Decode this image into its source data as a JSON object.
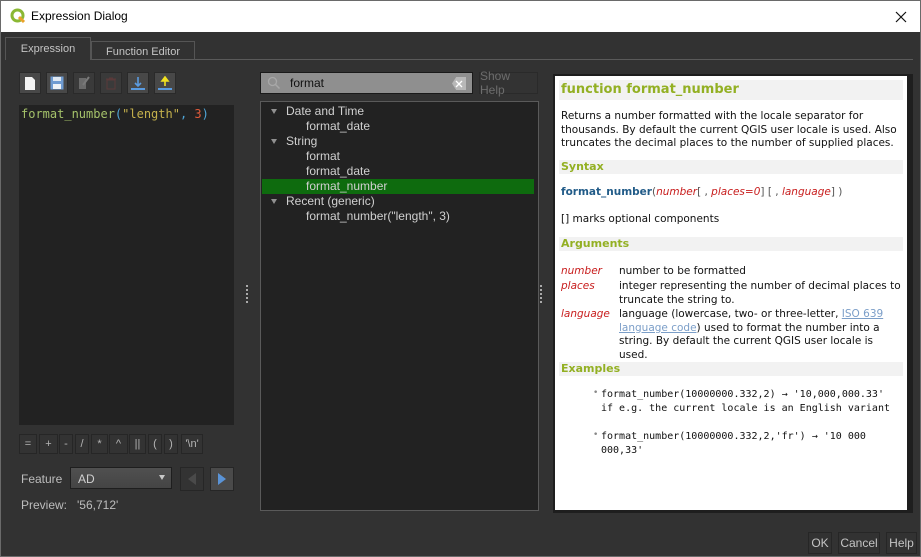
{
  "window": {
    "title": "Expression Dialog",
    "app_icon": "qgis-logo-icon",
    "close_icon": "close-icon"
  },
  "tabs": [
    {
      "label": "Expression",
      "active": true
    },
    {
      "label": "Function Editor",
      "active": false
    }
  ],
  "toolbar": {
    "buttons": [
      {
        "name": "new-file-icon",
        "tooltip": "New",
        "enabled": true
      },
      {
        "name": "save-icon",
        "tooltip": "Save",
        "enabled": true
      },
      {
        "name": "edit-icon",
        "tooltip": "Edit",
        "enabled": false
      },
      {
        "name": "delete-icon",
        "tooltip": "Delete",
        "enabled": false
      },
      {
        "name": "import-icon",
        "tooltip": "Import",
        "enabled": true
      },
      {
        "name": "export-icon",
        "tooltip": "Export",
        "enabled": true
      }
    ]
  },
  "editor": {
    "expression": "format_number(\"length\", 3)",
    "tokens": {
      "fn": "format_number",
      "open": "(",
      "str": "\"length\"",
      "comma": ", ",
      "num": "3",
      "close": ")"
    }
  },
  "operators": [
    "=",
    "+",
    "-",
    "/",
    "*",
    "^",
    "||",
    "(",
    ")",
    "'\\n'"
  ],
  "feature": {
    "label": "Feature",
    "selected": "AD"
  },
  "preview": {
    "label": "Preview:",
    "value": "'56,712'"
  },
  "search": {
    "value": "format",
    "show_help_label": "Show Help"
  },
  "tree": [
    {
      "label": "Date and Time",
      "group": true
    },
    {
      "label": "format_date",
      "group": false
    },
    {
      "label": "String",
      "group": true
    },
    {
      "label": "format",
      "group": false
    },
    {
      "label": "format_date",
      "group": false
    },
    {
      "label": "format_number",
      "group": false,
      "selected": true
    },
    {
      "label": "Recent (generic)",
      "group": true
    },
    {
      "label": "format_number(\"length\", 3)",
      "group": false
    }
  ],
  "help": {
    "title": "function format_number",
    "description": "Returns a number formatted with the locale separator for thousands. By default the current QGIS user locale is used. Also truncates the decimal places to the number of supplied places.",
    "syntax_header": "Syntax",
    "syntax": {
      "fn": "format_number",
      "open": "(",
      "arg1": "number",
      "opt1_open": "[ , ",
      "arg2": "places=0",
      "opt1_close": "]",
      "opt2_open": " [ , ",
      "arg3": "language",
      "opt2_close": "]",
      "close": " )"
    },
    "optional_note": "[] marks optional components",
    "arguments_header": "Arguments",
    "arguments": [
      {
        "name": "number",
        "desc": "number to be formatted"
      },
      {
        "name": "places",
        "desc": "integer representing the number of decimal places to truncate the string to."
      },
      {
        "name": "language",
        "desc_before": "language (lowercase, two- or three-letter, ",
        "link": "ISO 639 language code",
        "desc_after": ") used to format the number into a string. By default the current QGIS user locale is used."
      }
    ],
    "examples_header": "Examples",
    "examples": [
      "format_number(10000000.332,2) → '10,000,000.33' if e.g. the current locale is an English variant",
      "format_number(10000000.332,2,'fr') → '10 000 000,33'"
    ]
  },
  "buttons": {
    "ok": "OK",
    "cancel": "Cancel",
    "help": "Help"
  },
  "colors": {
    "selection": "#0e6b0e",
    "help_header": "#93b023",
    "syntax_fn": "#215b88",
    "syntax_arg": "#c81d1d"
  }
}
